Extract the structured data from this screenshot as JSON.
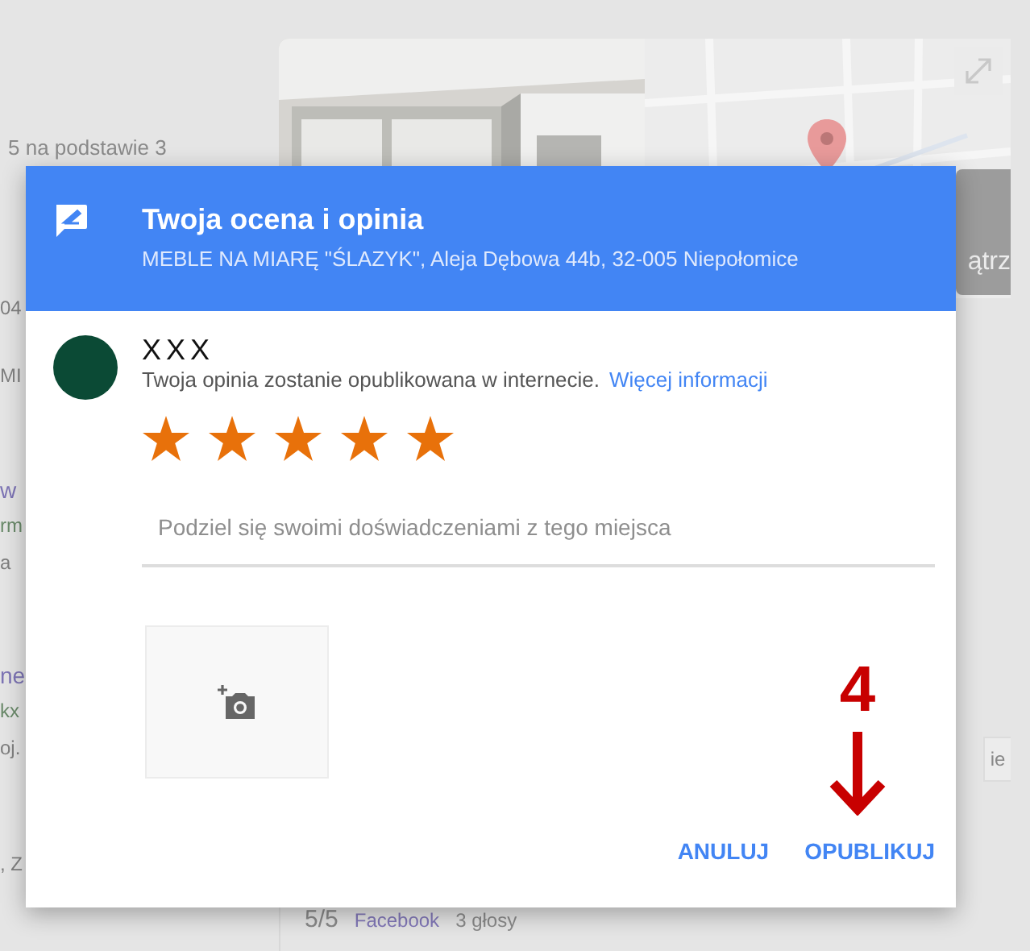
{
  "background": {
    "rating_summary": "5 na podstawie 3",
    "fragments": [
      {
        "text": "04",
        "kind": "plain"
      },
      {
        "text": "MI",
        "kind": "plain"
      },
      {
        "text": "w",
        "kind": "link"
      },
      {
        "text": "rm",
        "kind": "url"
      },
      {
        "text": "a",
        "kind": "plain"
      },
      {
        "text": "ne",
        "kind": "link"
      },
      {
        "text": "kx",
        "kind": "url"
      },
      {
        "text": "oj.",
        "kind": "plain"
      },
      {
        "text": ", Z",
        "kind": "plain"
      }
    ],
    "view_button": "ątrz",
    "side_button": "ie",
    "footer": {
      "score": "5/5",
      "source": "Facebook",
      "votes": "3 głosy"
    }
  },
  "dialog": {
    "title": "Twoja ocena i opinia",
    "subtitle": "MEBLE NA MIARĘ \"ŚLAZYK\", Aleja Dębowa 44b, 32-005 Niepołomice",
    "user": {
      "name": "XXX",
      "notice": "Twoja opinia zostanie opublikowana w internecie.",
      "link": "Więcej informacji"
    },
    "stars": 5,
    "review_field": {
      "placeholder": "Podziel się swoimi doświadczeniami z tego miejsca"
    },
    "buttons": [
      "ANULUJ",
      "OPUBLIKUJ"
    ],
    "annotation": {
      "label": "4"
    }
  }
}
